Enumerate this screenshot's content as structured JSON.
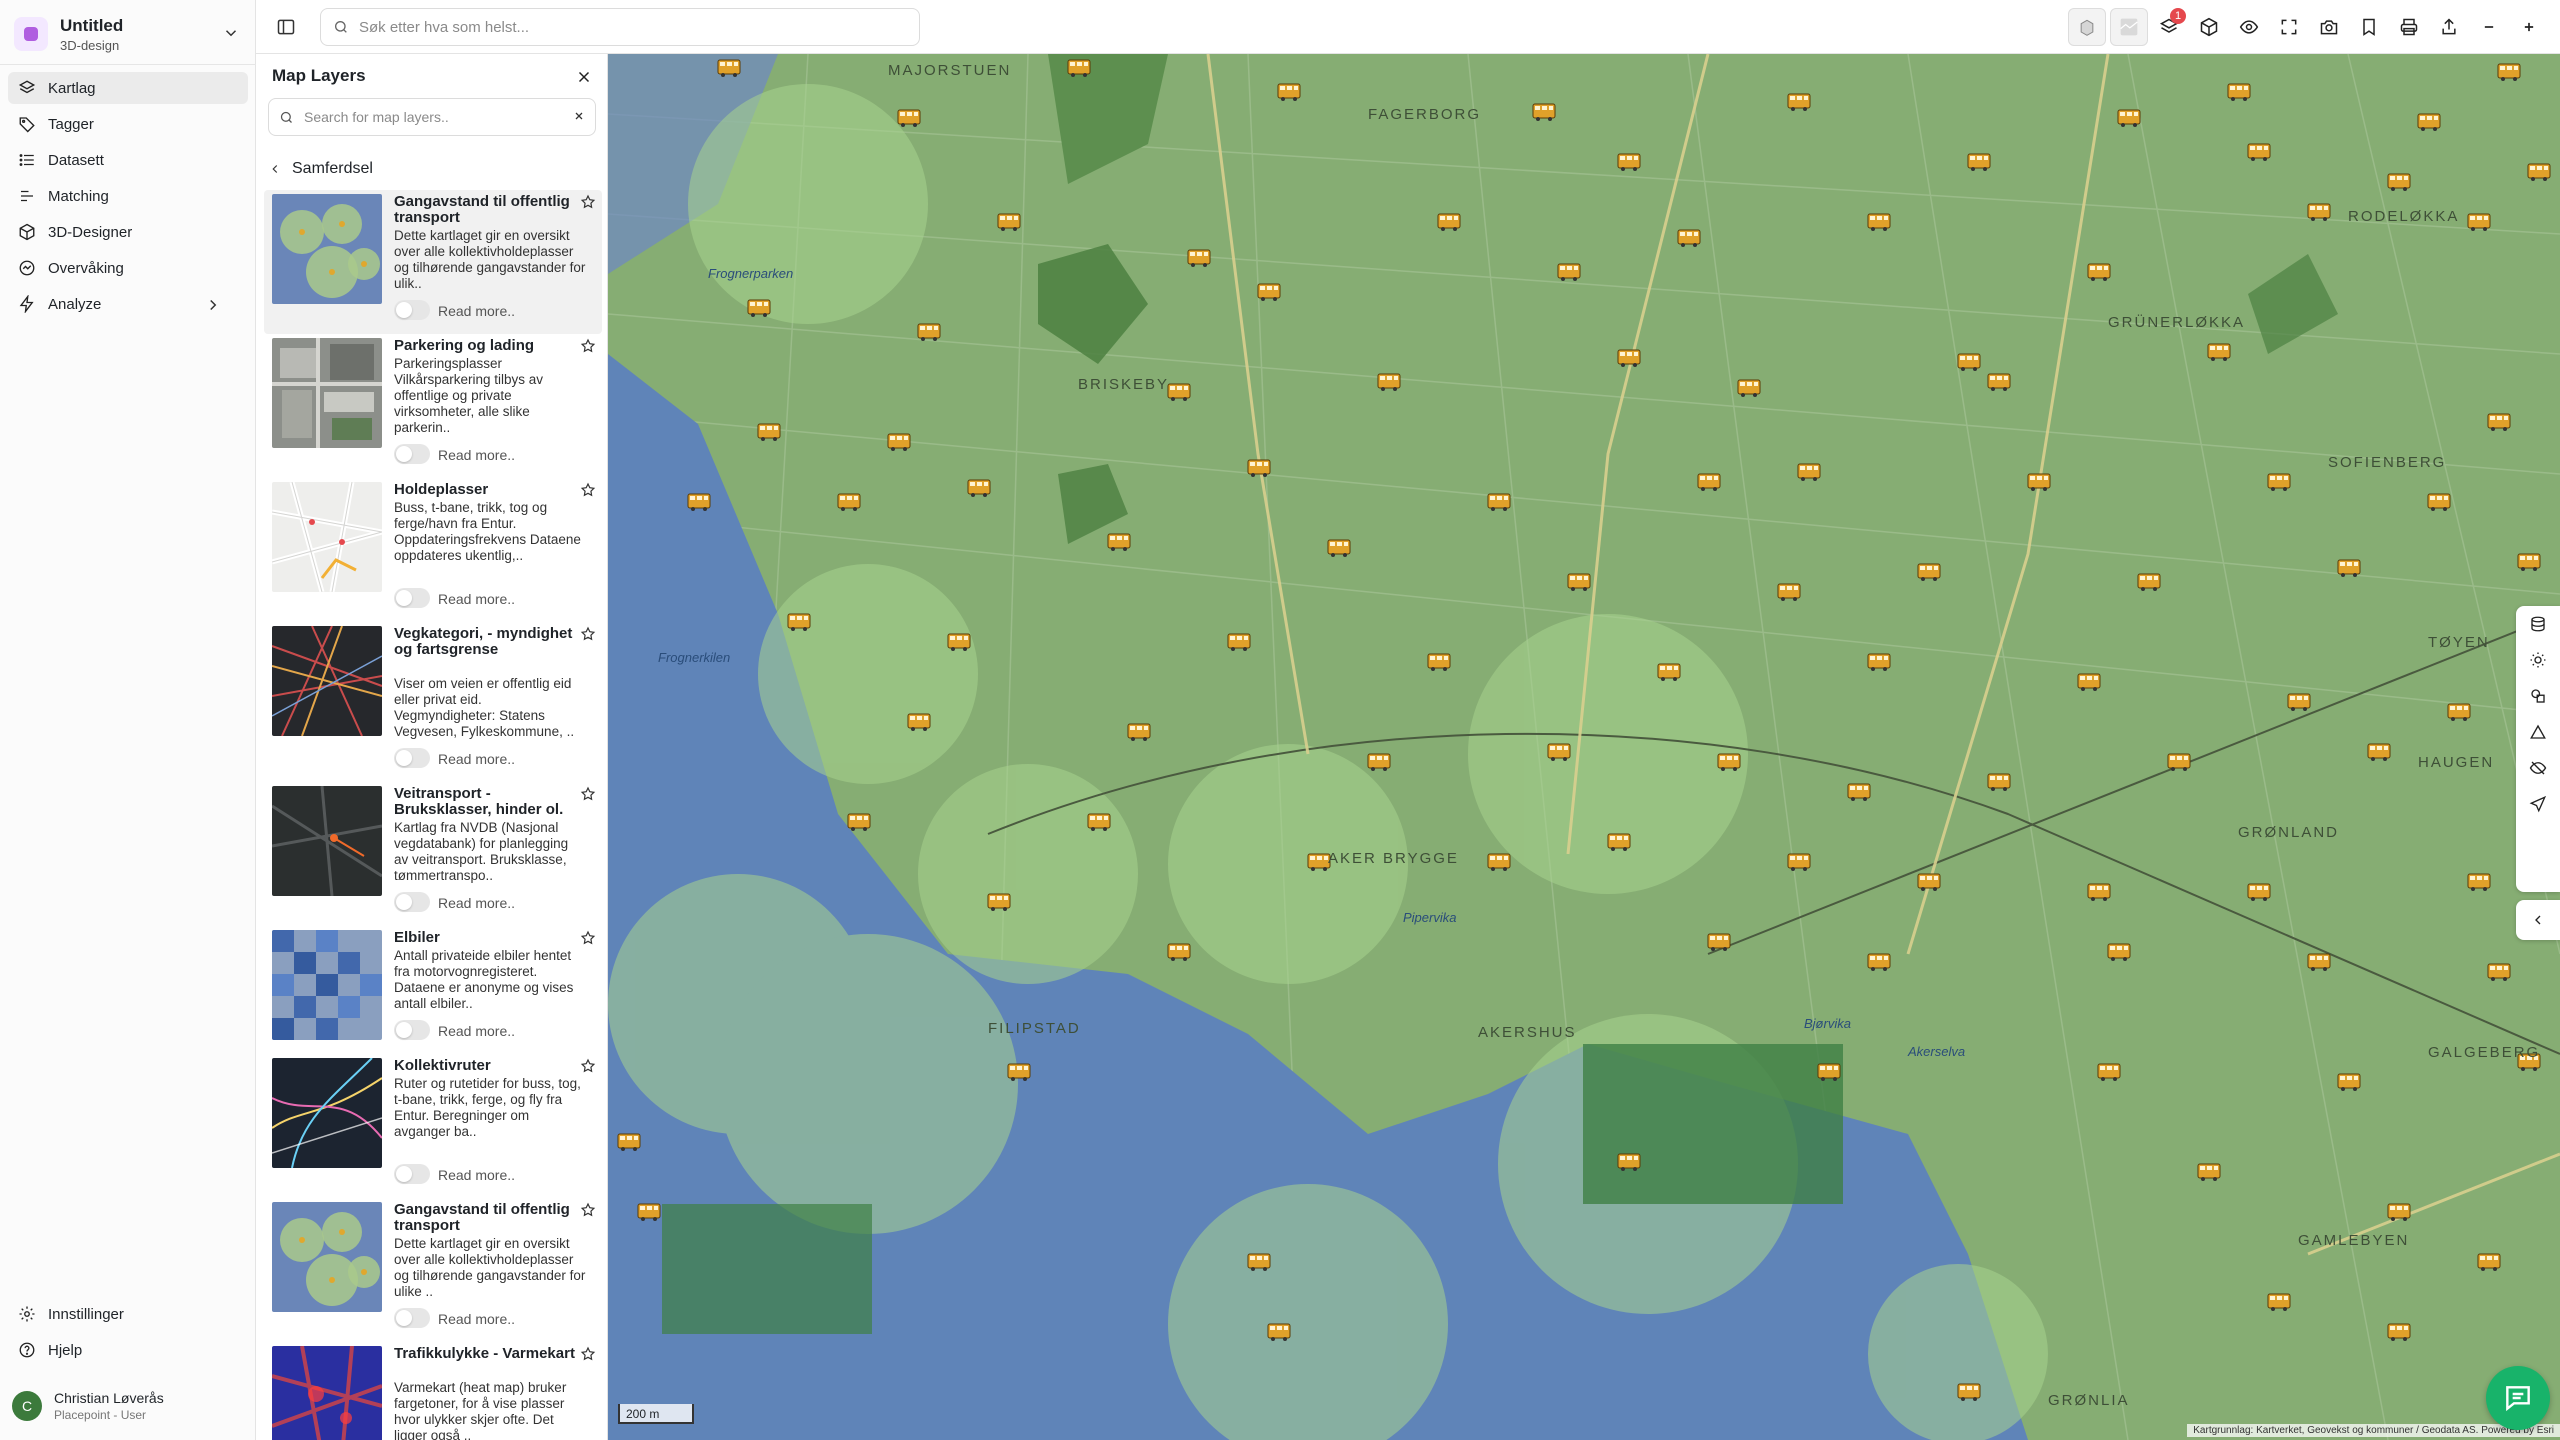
{
  "project": {
    "title": "Untitled",
    "subtitle": "3D-design"
  },
  "nav": {
    "items": [
      {
        "label": "Kartlag",
        "icon": "layers-icon",
        "active": true
      },
      {
        "label": "Tagger",
        "icon": "tag-icon"
      },
      {
        "label": "Datasett",
        "icon": "list-icon"
      },
      {
        "label": "Matching",
        "icon": "matching-icon"
      },
      {
        "label": "3D-Designer",
        "icon": "cube-icon"
      },
      {
        "label": "Overvåking",
        "icon": "monitor-icon"
      },
      {
        "label": "Analyze",
        "icon": "analyze-icon"
      }
    ],
    "bottom": [
      {
        "label": "Innstillinger",
        "icon": "gear-icon"
      },
      {
        "label": "Hjelp",
        "icon": "help-icon"
      }
    ]
  },
  "user": {
    "initial": "C",
    "name": "Christian Løverås",
    "role": "Placepoint - User"
  },
  "search": {
    "placeholder": "Søk etter hva som helst..."
  },
  "toolbar": {
    "layers_badge": "1"
  },
  "panel": {
    "title": "Map Layers",
    "search_placeholder": "Search for map layers..",
    "category": "Samferdsel",
    "read_more": "Read more..",
    "layers": [
      {
        "title": "Gangavstand til offentlig transport",
        "description": "Dette kartlaget gir en oversikt over alle kollektivholdeplasser og tilhørende gangavstander for ulik..",
        "thumb": "walk-distance"
      },
      {
        "title": "Parkering og lading",
        "description": "Parkeringsplasser Vilkårsparkering tilbys av offentlige og private virksomheter, alle slike parkerin..",
        "thumb": "aerial"
      },
      {
        "title": "Holdeplasser",
        "description": "Buss, t-bane, trikk, tog og ferge/havn fra Entur. Oppdateringsfrekvens Dataene oppdateres ukentlig,..",
        "thumb": "street-map"
      },
      {
        "title": "Vegkategori, - myndighet og fartsgrense",
        "description": "Viser om veien er offentlig eid eller privat eid. Vegmyndigheter: Statens Vegvesen, Fylkeskommune, ..",
        "thumb": "roads-dark"
      },
      {
        "title": "Veitransport - Bruksklasser, hinder ol.",
        "description": "Kartlag fra NVDB (Nasjonal vegdatabank) for planlegging av veitransport. Bruksklasse, tømmertranspo..",
        "thumb": "roads-dark2"
      },
      {
        "title": "Elbiler",
        "description": "Antall privateide elbiler hentet fra motorvognregisteret. Dataene er anonyme og vises antall elbiler..",
        "thumb": "ev-grid"
      },
      {
        "title": "Kollektivruter",
        "description": "Ruter og rutetider for buss, tog, t-bane, trikk, ferge, og fly fra Entur. Beregninger om avganger ba..",
        "thumb": "routes"
      },
      {
        "title": "Gangavstand til offentlig transport",
        "description": "Dette kartlaget gir en oversikt over alle kollektivholdeplasser og tilhørende gangavstander for ulike ..",
        "thumb": "walk-distance"
      },
      {
        "title": "Trafikkulykke - Varmekart",
        "description": "Varmekart (heat map) bruker fargetoner, for å vise plasser hvor ulykker skjer ofte. Det ligger også ..",
        "thumb": "heatmap"
      }
    ]
  },
  "map": {
    "places": [
      "MAJORSTUEN",
      "FAGERBORG",
      "BRISKEBY",
      "RODELØKKA",
      "GRÜNERLØKKA",
      "SOFIENBERG",
      "AKER BRYGGE",
      "FILIPSTAD",
      "AKERSHUS",
      "GRØNLAND",
      "GAMLEBYEN",
      "TØYEN",
      "GALGEBERG",
      "HAUGEN",
      "GRØNLIA"
    ],
    "water_labels": [
      "Frognerkilen",
      "Pipervika",
      "Bjørvika",
      "Akerselva",
      "Frognerparken"
    ],
    "scale": "200 m",
    "attribution": "Kartgrunnlag: Kartverket, Geovekst og kommuner / Geodata AS. Powered by Esri"
  }
}
